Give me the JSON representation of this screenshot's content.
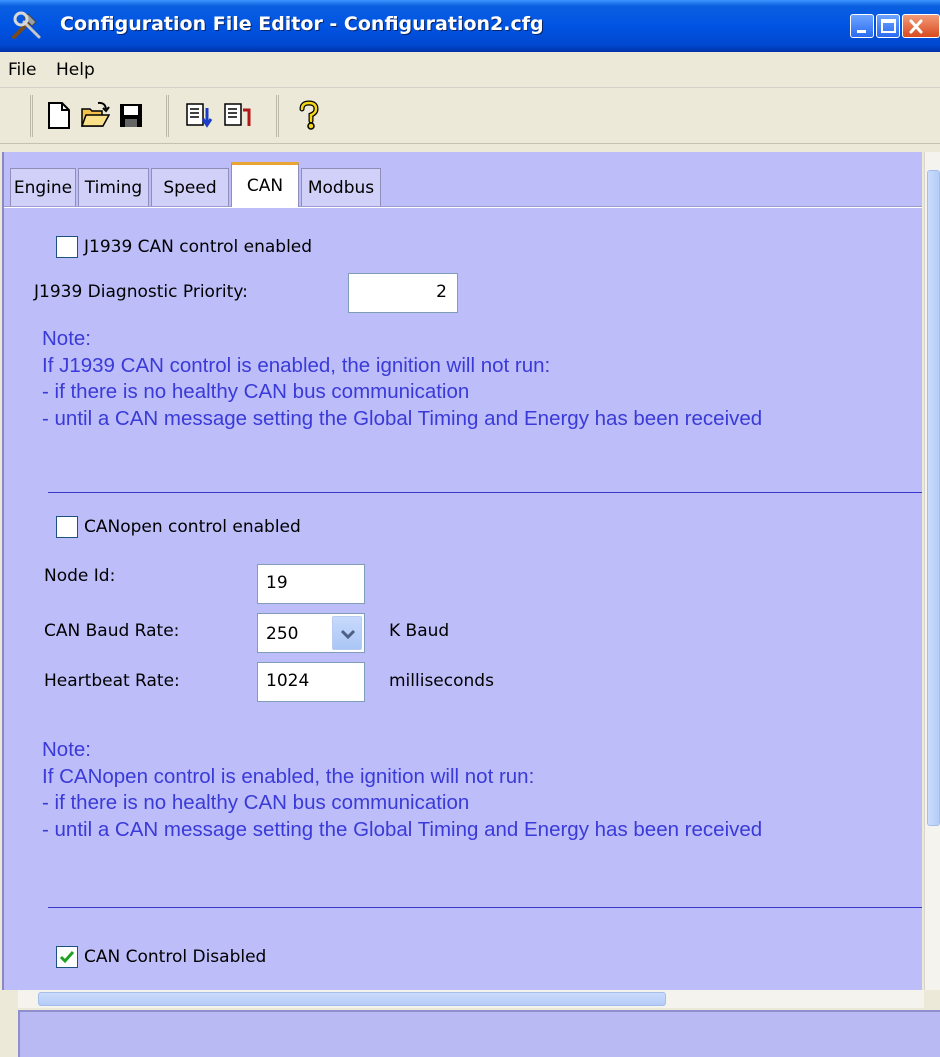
{
  "window": {
    "title": "Configuration File Editor - Configuration2.cfg",
    "app_icon": "tools-icon"
  },
  "menu": {
    "file_label": "File",
    "help_label": "Help"
  },
  "toolbar": {
    "icons": [
      "new-file-icon",
      "open-folder-icon",
      "save-icon",
      "download-config-icon",
      "upload-config-icon",
      "help-icon"
    ]
  },
  "tabs": [
    {
      "label": "Engine",
      "active": false
    },
    {
      "label": "Timing",
      "active": false
    },
    {
      "label": "Speed",
      "active": false
    },
    {
      "label": "CAN",
      "active": true
    },
    {
      "label": "Modbus",
      "active": false
    }
  ],
  "j1939": {
    "enabled_label": "J1939 CAN control enabled",
    "enabled": false,
    "priority_label": "J1939 Diagnostic Priority:",
    "priority_value": "2",
    "note": [
      "Note:",
      "If J1939 CAN control is enabled, the ignition will not run:",
      "- if there is no healthy CAN bus communication",
      "- until a CAN message setting the Global Timing and Energy has been received"
    ]
  },
  "canopen": {
    "enabled_label": "CANopen control enabled",
    "enabled": false,
    "node_id_label": "Node Id:",
    "node_id_value": "19",
    "baud_label": "CAN Baud Rate:",
    "baud_value": "250",
    "baud_unit": "K Baud",
    "heartbeat_label": "Heartbeat Rate:",
    "heartbeat_value": "1024",
    "heartbeat_unit": "milliseconds",
    "note": [
      "Note:",
      "If CANopen control is enabled, the ignition will not run:",
      "- if there is no healthy CAN bus communication",
      "- until a CAN message setting the Global Timing and Energy has been received"
    ]
  },
  "disabled": {
    "label": "CAN Control Disabled",
    "checked": true
  },
  "colors": {
    "panel_bg": "#bdbdfa",
    "note_text": "#3a3ad8",
    "titlebar": "#0054e3"
  }
}
